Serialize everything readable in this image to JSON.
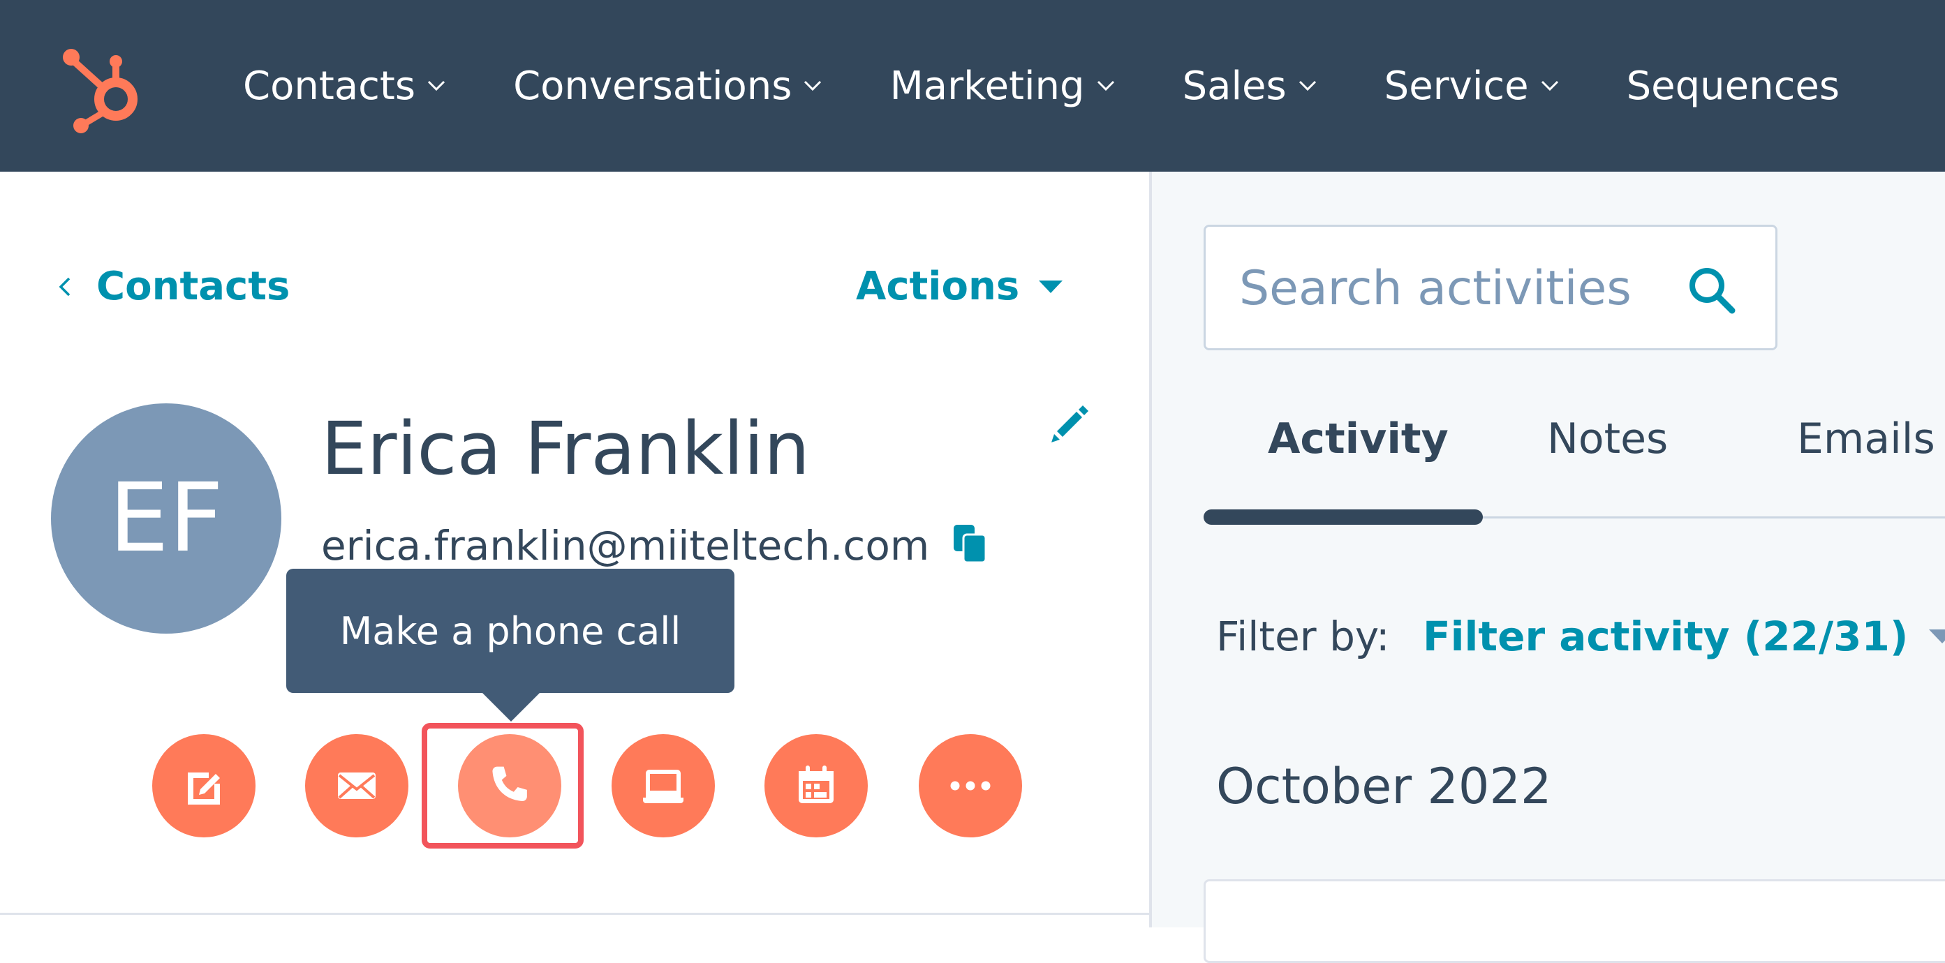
{
  "nav": {
    "items": [
      {
        "label": "Contacts"
      },
      {
        "label": "Conversations"
      },
      {
        "label": "Marketing"
      },
      {
        "label": "Sales"
      },
      {
        "label": "Service"
      },
      {
        "label": "Sequences"
      }
    ]
  },
  "header": {
    "back_label": "Contacts",
    "actions_label": "Actions"
  },
  "contact": {
    "initials": "EF",
    "name": "Erica Franklin",
    "email": "erica.franklin@miiteltech.com"
  },
  "tooltip": {
    "text": "Make a phone call"
  },
  "action_buttons": [
    {
      "icon": "note-icon"
    },
    {
      "icon": "email-icon"
    },
    {
      "icon": "phone-icon"
    },
    {
      "icon": "task-icon"
    },
    {
      "icon": "calendar-icon"
    },
    {
      "icon": "more-icon"
    }
  ],
  "activity": {
    "search_placeholder": "Search activities",
    "tabs": [
      {
        "label": "Activity"
      },
      {
        "label": "Notes"
      },
      {
        "label": "Emails"
      }
    ],
    "filter_label": "Filter by:",
    "filter_value": "Filter activity (22/31)",
    "month": "October 2022"
  },
  "colors": {
    "nav_bg": "#33475b",
    "accent": "#0091ae",
    "action": "#ff7a59",
    "highlight": "#f2545b",
    "logo": "#ff7a59"
  }
}
